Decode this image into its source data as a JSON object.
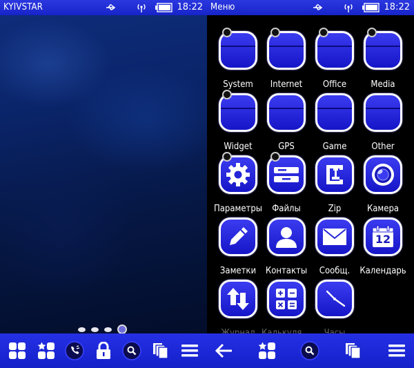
{
  "left_screen": {
    "status": {
      "carrier": "KYIVSTAR",
      "time": "18:22"
    },
    "page_count": 4,
    "active_page": 4,
    "dock": [
      "apps-grid-icon",
      "favorites-icon",
      "phone-icon",
      "lock-icon",
      "search-icon",
      "task-switcher-icon",
      "menu-icon"
    ]
  },
  "right_screen": {
    "status": {
      "title": "Меню",
      "time": "18:22"
    },
    "grid": [
      {
        "label": "System",
        "icon": "folder-icon"
      },
      {
        "label": "Internet",
        "icon": "folder-icon"
      },
      {
        "label": "Office",
        "icon": "folder-icon"
      },
      {
        "label": "Media",
        "icon": "folder-icon"
      },
      {
        "label": "Widget",
        "icon": "folder-icon"
      },
      {
        "label": "GPS",
        "icon": "folder-icon"
      },
      {
        "label": "Game",
        "icon": "folder-icon"
      },
      {
        "label": "Other",
        "icon": "folder-icon"
      },
      {
        "label": "Параметры",
        "icon": "gear-icon"
      },
      {
        "label": "Файлы",
        "icon": "file-manager-icon"
      },
      {
        "label": "Zip",
        "icon": "clamp-icon"
      },
      {
        "label": "Камера",
        "icon": "camera-lens-icon"
      },
      {
        "label": "Заметки",
        "icon": "pencil-icon"
      },
      {
        "label": "Контакты",
        "icon": "contact-icon"
      },
      {
        "label": "Сообщ.",
        "icon": "envelope-icon"
      },
      {
        "label": "Календарь",
        "icon": "calendar-icon"
      },
      {
        "label": "Журнал",
        "icon": "arrows-icon"
      },
      {
        "label": "Калькулятор",
        "icon": "calculator-icon"
      },
      {
        "label": "Часы",
        "icon": "clock-icon"
      }
    ],
    "calendar_day": "12",
    "dock": [
      "back-arrow-icon",
      "favorites-icon",
      "search-icon",
      "task-switcher-icon",
      "menu-icon"
    ]
  },
  "colors": {
    "accent": "#1f2ad8",
    "tile": "#2a2ae0",
    "wallpaper_dark": "#061846"
  }
}
